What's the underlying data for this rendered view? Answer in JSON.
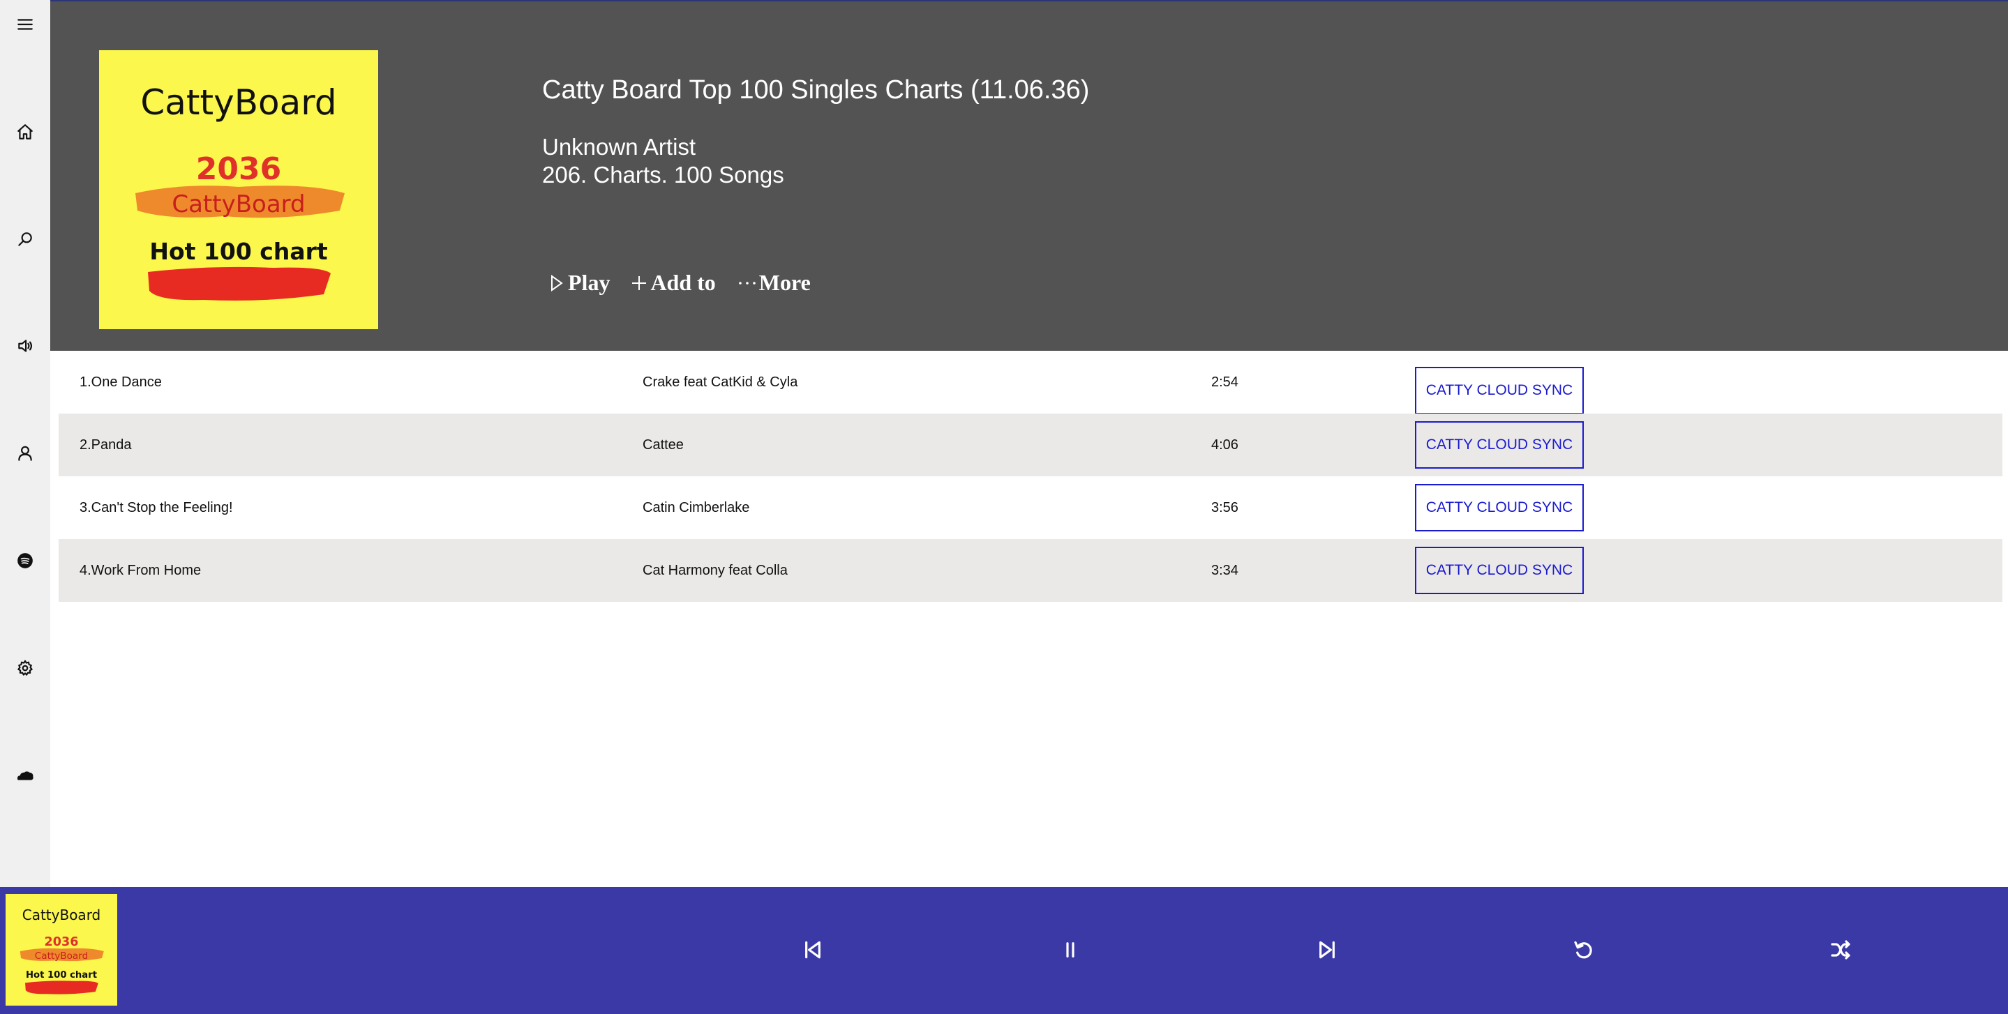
{
  "album": {
    "title": "Catty Board Top 100 Singles Charts (11.06.36)",
    "artist": "Unknown Artist",
    "subtitle": "206. Charts. 100 Songs",
    "cover_text": {
      "brand": "CattyBoard",
      "year": "2036",
      "brand2": "CattyBoard",
      "chart": "Hot 100 chart"
    }
  },
  "actions": {
    "play": "Play",
    "add": "Add to",
    "more": "More"
  },
  "tracks": [
    {
      "title": "1.One Dance",
      "artist": "Crake feat CatKid & Cyla",
      "duration": "2:54",
      "action": "CATTY CLOUD SYNC"
    },
    {
      "title": "2.Panda",
      "artist": "Cattee",
      "duration": "4:06",
      "action": "CATTY CLOUD SYNC"
    },
    {
      "title": "3.Can't Stop the Feeling!",
      "artist": "Catin Cimberlake",
      "duration": "3:56",
      "action": "CATTY CLOUD SYNC"
    },
    {
      "title": "4.Work From Home",
      "artist": "Cat Harmony feat Colla",
      "duration": "3:34",
      "action": "CATTY CLOUD SYNC"
    }
  ],
  "nav_icons": [
    "menu-icon",
    "home-icon",
    "search-icon",
    "speaker-icon",
    "user-icon",
    "spotify-icon",
    "gear-icon",
    "cloud-icon"
  ],
  "player_icons": [
    "previous-icon",
    "pause-icon",
    "next-icon",
    "repeat-icon",
    "shuffle-icon"
  ],
  "colors": {
    "header_bg": "#535353",
    "player_bg": "#3a39a5",
    "sync_blue": "#1a1acf",
    "rail_bg": "#f0f0f0",
    "row_alt": "#ebe9e8",
    "cover_yellow": "#fbf74c"
  }
}
